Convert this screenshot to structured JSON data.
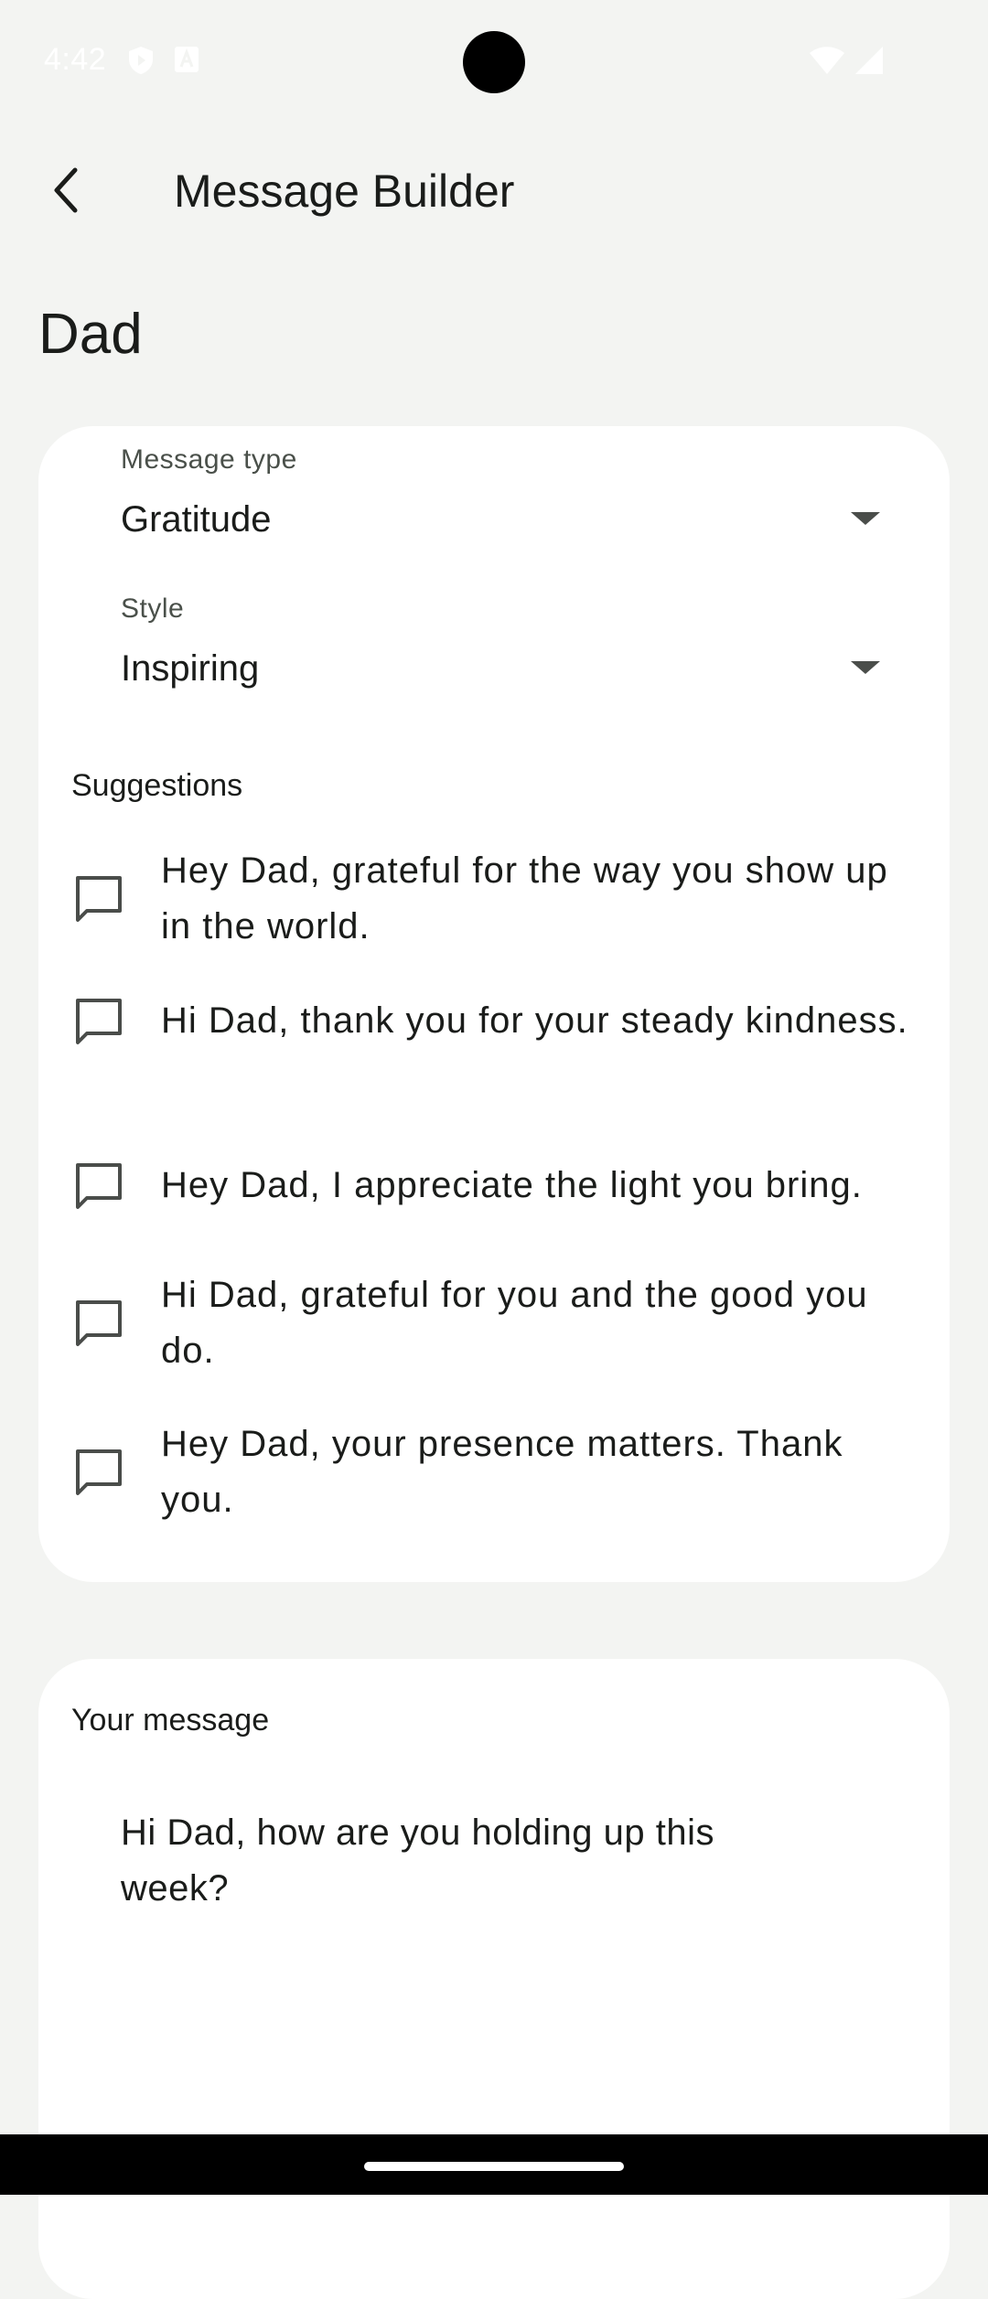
{
  "status": {
    "time": "4:42"
  },
  "header": {
    "title": "Message Builder"
  },
  "recipient": "Dad",
  "message_type": {
    "label": "Message type",
    "value": "Gratitude"
  },
  "style": {
    "label": "Style",
    "value": "Inspiring"
  },
  "suggestions": {
    "title": "Suggestions",
    "items": [
      "Hey Dad, grateful for the way you show up in the world.",
      "Hi Dad, thank you for your steady kindness.",
      "Hey Dad, I appreciate the light you bring.",
      "Hi Dad, grateful for you and the good you do.",
      "Hey Dad, your presence matters. Thank you."
    ]
  },
  "your_message": {
    "title": "Your message",
    "text": "Hi Dad, how are you holding up this week?"
  }
}
